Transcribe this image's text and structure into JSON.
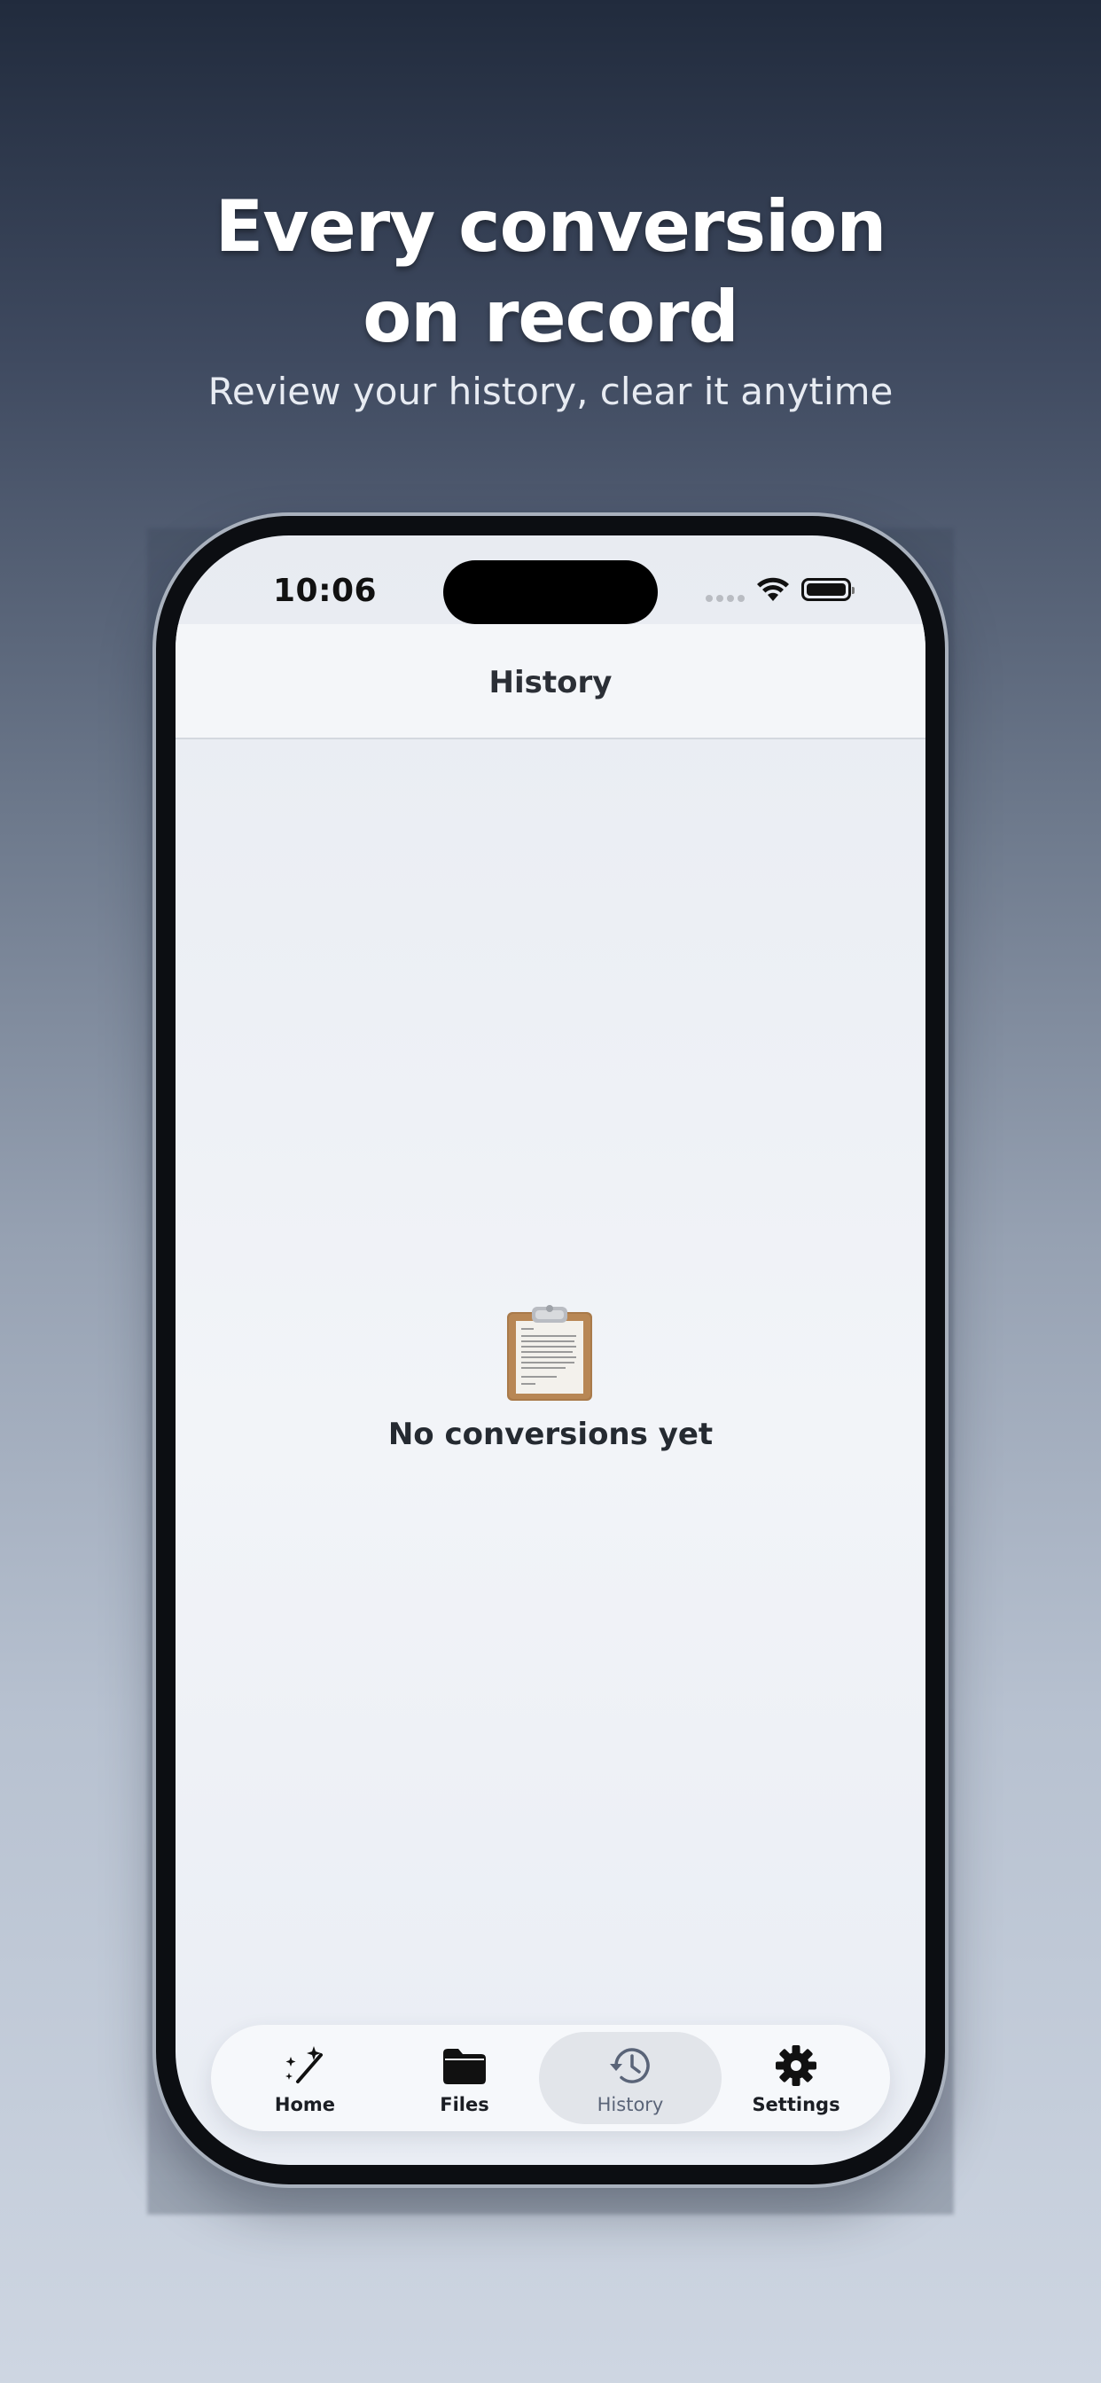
{
  "promo": {
    "headline_line1": "Every conversion",
    "headline_line2": "on record",
    "subheadline": "Review your history, clear it anytime"
  },
  "status_bar": {
    "time": "10:06"
  },
  "nav": {
    "title": "History"
  },
  "empty_state": {
    "icon": "clipboard-icon",
    "message": "No conversions yet"
  },
  "tab_bar": {
    "selected": "History",
    "tabs": [
      {
        "label": "Home",
        "icon": "magic-wand-icon"
      },
      {
        "label": "Files",
        "icon": "folder-icon"
      },
      {
        "label": "History",
        "icon": "history-clock-icon"
      },
      {
        "label": "Settings",
        "icon": "gear-icon"
      }
    ]
  },
  "colors": {
    "active_tab_text": "#5a6478",
    "active_tab_bg": "#e2e5ea",
    "text_dark": "#252a31"
  }
}
